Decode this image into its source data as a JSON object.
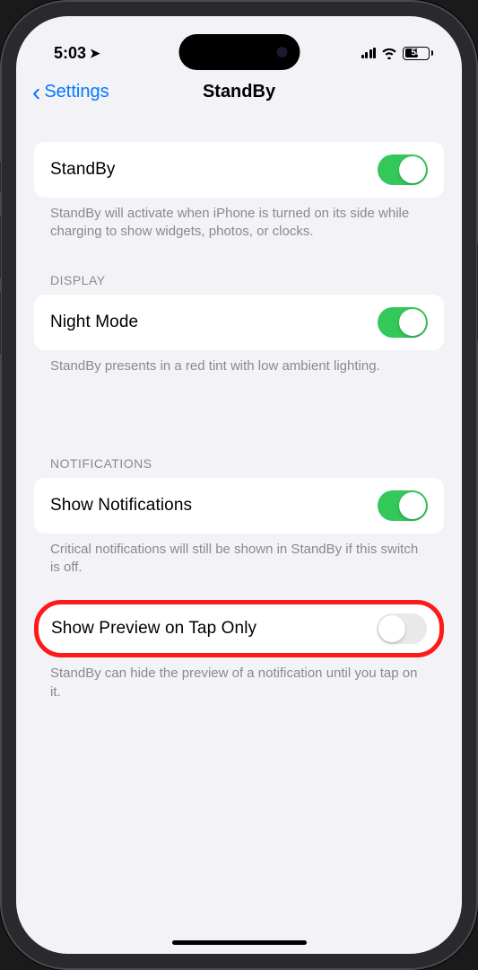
{
  "statusBar": {
    "time": "5:03",
    "battery": "58"
  },
  "nav": {
    "backLabel": "Settings",
    "title": "StandBy"
  },
  "standby": {
    "label": "StandBy",
    "footer": "StandBy will activate when iPhone is turned on its side while charging to show widgets, photos, or clocks."
  },
  "display": {
    "header": "DISPLAY",
    "nightMode": {
      "label": "Night Mode",
      "footer": "StandBy presents in a red tint with low ambient lighting."
    }
  },
  "notifications": {
    "header": "NOTIFICATIONS",
    "show": {
      "label": "Show Notifications",
      "footer": "Critical notifications will still be shown in StandBy if this switch is off."
    },
    "preview": {
      "label": "Show Preview on Tap Only",
      "footer": "StandBy can hide the preview of a notification until you tap on it."
    }
  }
}
